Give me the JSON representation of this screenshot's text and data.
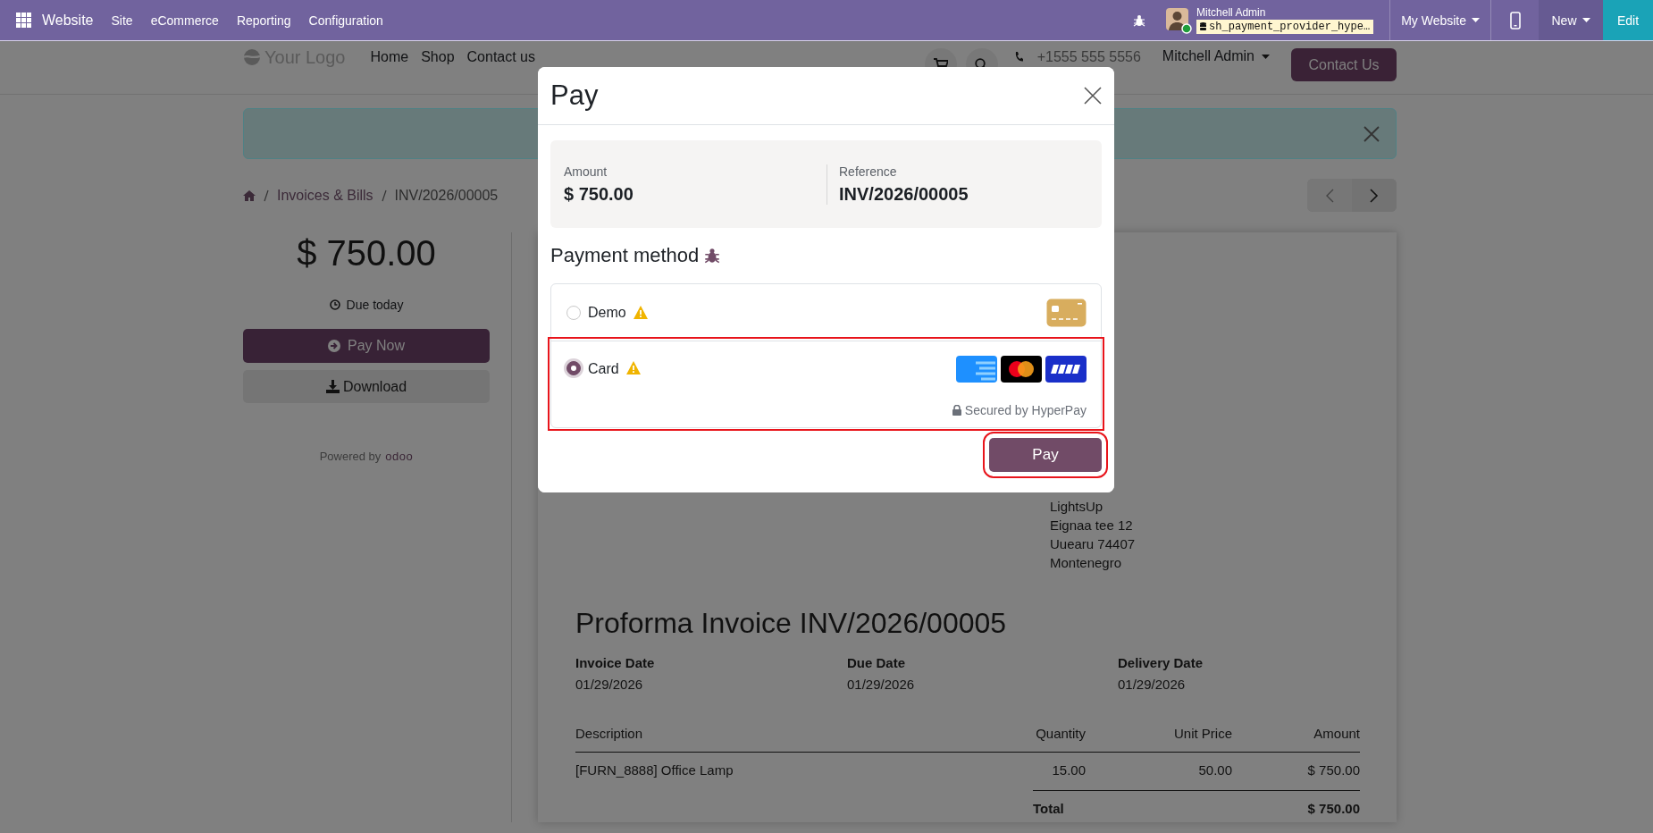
{
  "topbar": {
    "app": "Website",
    "menu": [
      {
        "label": "Site"
      },
      {
        "label": "eCommerce"
      },
      {
        "label": "Reporting"
      },
      {
        "label": "Configuration"
      }
    ],
    "user_name": "Mitchell Admin",
    "database": "sh_payment_provider_hype…",
    "website_switch": "My Website",
    "new_button": "New",
    "edit_button": "Edit"
  },
  "site_header": {
    "logo": "Your Logo",
    "nav": [
      {
        "label": "Home"
      },
      {
        "label": "Shop"
      },
      {
        "label": "Contact us"
      }
    ],
    "phone": "+1555 555 5556",
    "user": "Mitchell Admin",
    "cta": "Contact Us"
  },
  "breadcrumb": [
    {
      "label": "Invoices & Bills",
      "kind": "link"
    },
    {
      "label": "INV/2026/00005",
      "kind": "current"
    }
  ],
  "sidebar": {
    "amount": "$ 750.00",
    "due": "Due today",
    "pay_now": "Pay Now",
    "download": "Download",
    "powered_by": "Powered by",
    "powered_brand": "odoo"
  },
  "invoice": {
    "partner": [
      "LightsUp",
      "Eignaa tee 12",
      "Uuearu 74407",
      "Montenegro"
    ],
    "title": "Proforma Invoice INV/2026/00005",
    "dates": [
      {
        "label": "Invoice Date",
        "value": "01/29/2026"
      },
      {
        "label": "Due Date",
        "value": "01/29/2026"
      },
      {
        "label": "Delivery Date",
        "value": "01/29/2026"
      }
    ],
    "columns": [
      "Description",
      "Quantity",
      "Unit Price",
      "Amount"
    ],
    "rows": [
      [
        "[FURN_8888] Office Lamp",
        "15.00",
        "50.00",
        "$ 750.00"
      ]
    ],
    "total_label": "Total",
    "total": "$ 750.00"
  },
  "dialog": {
    "title": "Pay",
    "amount_label": "Amount",
    "amount": "$ 750.00",
    "reference_label": "Reference",
    "reference": "INV/2026/00005",
    "section_title": "Payment method",
    "methods": [
      {
        "name": "Demo",
        "selected": false,
        "highlighted": false,
        "logos": [
          {
            "kind": "generic-card"
          }
        ]
      },
      {
        "name": "Card",
        "selected": true,
        "highlighted": true,
        "logos": [
          {
            "kind": "amex"
          },
          {
            "kind": "mastercard"
          },
          {
            "kind": "visa"
          }
        ],
        "note": "Secured by HyperPay"
      }
    ],
    "pay_button": {
      "label": "Pay",
      "highlighted": true
    }
  }
}
